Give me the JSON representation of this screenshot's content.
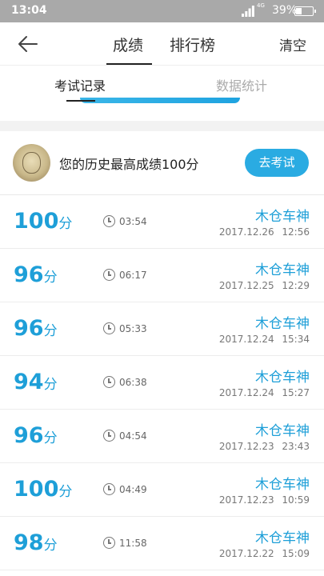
{
  "status_bar": {
    "time": "13:04",
    "network": "4G",
    "battery": "39%",
    "battery_level": 0.39
  },
  "nav": {
    "tabs": [
      {
        "label": "成绩",
        "active": true
      },
      {
        "label": "排行榜",
        "active": false
      }
    ],
    "clear_label": "清空"
  },
  "sub_tabs": [
    {
      "label": "考试记录",
      "active": true
    },
    {
      "label": "数据统计",
      "active": false
    }
  ],
  "best": {
    "text": "您的历史最高成绩100分",
    "button_label": "去考试"
  },
  "records": [
    {
      "score": "100",
      "unit": "分",
      "duration": "03:54",
      "name": "木仓车神",
      "date": "2017.12.26 12:56"
    },
    {
      "score": "96",
      "unit": "分",
      "duration": "06:17",
      "name": "木仓车神",
      "date": "2017.12.25 12:29"
    },
    {
      "score": "96",
      "unit": "分",
      "duration": "05:33",
      "name": "木仓车神",
      "date": "2017.12.24 15:34"
    },
    {
      "score": "94",
      "unit": "分",
      "duration": "06:38",
      "name": "木仓车神",
      "date": "2017.12.24 15:27"
    },
    {
      "score": "96",
      "unit": "分",
      "duration": "04:54",
      "name": "木仓车神",
      "date": "2017.12.23 23:43"
    },
    {
      "score": "100",
      "unit": "分",
      "duration": "04:49",
      "name": "木仓车神",
      "date": "2017.12.23 10:59"
    },
    {
      "score": "98",
      "unit": "分",
      "duration": "11:58",
      "name": "木仓车神",
      "date": "2017.12.22 15:09"
    }
  ],
  "colors": {
    "accent": "#1e9fd8",
    "button": "#2aabe2",
    "status_bar": "#a9a9a9"
  },
  "icons": {
    "back": "arrow-left-icon",
    "clock": "clock-icon",
    "signal": "signal-bars-icon",
    "battery": "battery-icon"
  }
}
